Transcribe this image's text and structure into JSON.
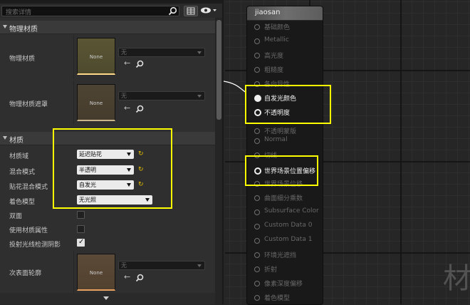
{
  "search": {
    "placeholder": "搜索详情"
  },
  "categories": {
    "physical": "物理材质",
    "material": "材质"
  },
  "physical_rows": [
    {
      "label": "物理材质",
      "thumb": "None",
      "value": "无"
    },
    {
      "label": "物理材质遮罩",
      "thumb": "None",
      "value": "无"
    }
  ],
  "material_rows": [
    {
      "label": "材质域",
      "value": "延迟贴花"
    },
    {
      "label": "混合模式",
      "value": "半透明"
    },
    {
      "label": "贴花混合模式",
      "value": "自发光"
    },
    {
      "label": "着色模型",
      "value": "无光照"
    },
    {
      "label": "双面"
    },
    {
      "label": "使用材质属性"
    },
    {
      "label": "投射光线检测阴影"
    },
    {
      "label": "次表面轮廓",
      "thumb": "None",
      "value": "无"
    }
  ],
  "checkboxes": {
    "two_sided": false,
    "use_material_attributes": false,
    "cast_ray_traced_shadows": true
  },
  "node": {
    "title": "jiaosan",
    "pins": [
      "基础颜色",
      "Metallic",
      "高光度",
      "粗糙度",
      "各向异性",
      "自发光颜色",
      "不透明度",
      "不透明蒙版",
      "Normal",
      "切线",
      "世界场景位置偏移",
      "世界场景位移",
      "曲面细分乘数",
      "Subsurface Color",
      "Custom Data 0",
      "Custom Data 1",
      "环境光遮挡",
      "折射",
      "像素深度偏移",
      "着色模型"
    ]
  },
  "watermark": "材",
  "colors": {
    "highlight": "#ffff00",
    "reset_arrow": "#e8c000"
  }
}
